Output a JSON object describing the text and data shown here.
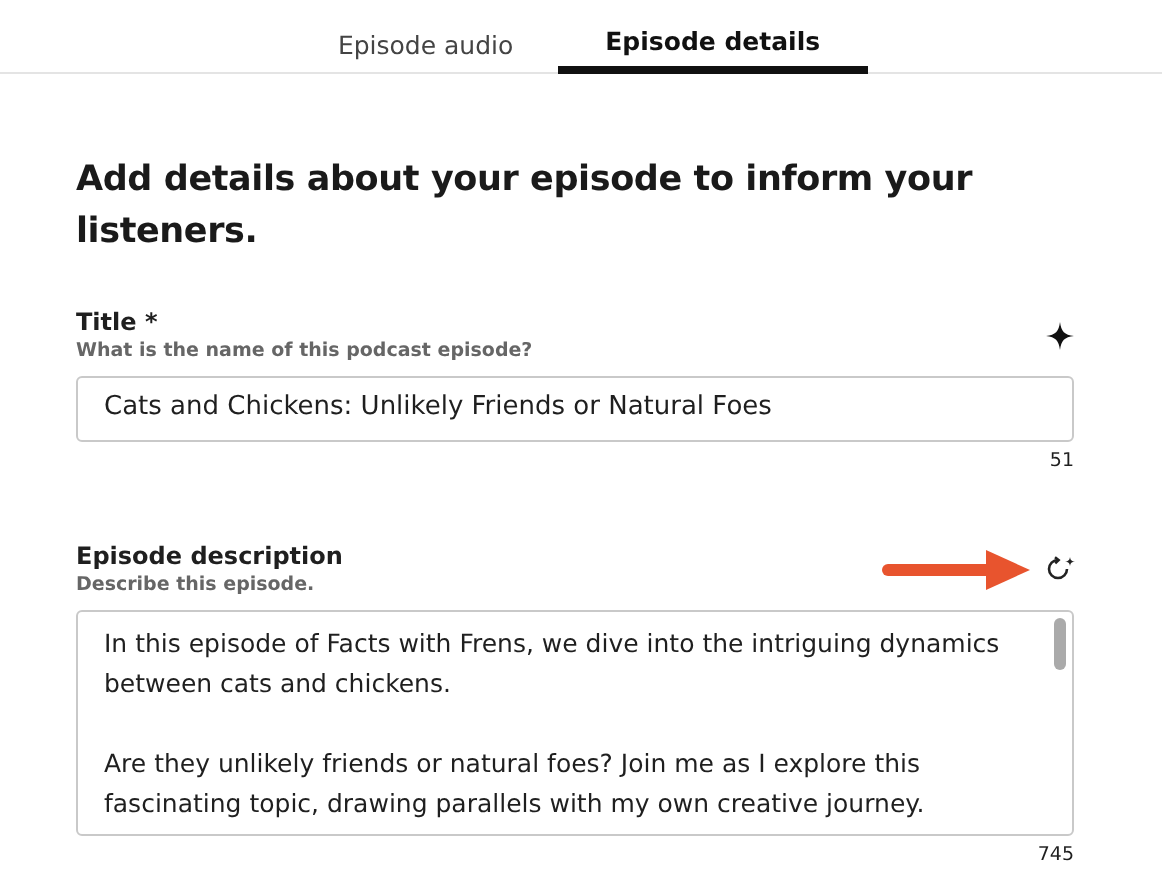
{
  "tabs": [
    {
      "label": "Episode audio",
      "selected": false
    },
    {
      "label": "Episode details",
      "selected": true
    }
  ],
  "heading": "Add details about your episode to inform your listeners.",
  "fields": [
    {
      "kind": "input",
      "label": "Title *",
      "hint": "What is the name of this podcast episode?",
      "value": "Cats and Chickens: Unlikely Friends or Natural Foes",
      "counter": "51"
    },
    {
      "kind": "textarea",
      "label": "Episode description",
      "hint": "Describe this episode.",
      "paragraphs": [
        "In this episode of Facts with Frens, we dive into the intriguing dynamics between cats and chickens.",
        "Are they unlikely friends or natural foes? Join me as I explore this fascinating topic, drawing parallels with my own creative journey."
      ],
      "counter": "745"
    }
  ]
}
